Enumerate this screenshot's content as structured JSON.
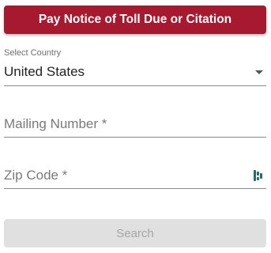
{
  "pay_button": {
    "label": "Pay Notice of Toll Due or Citation",
    "color": "#a6192e"
  },
  "country_select": {
    "label": "Select Country",
    "value": "United States"
  },
  "mailing_number": {
    "placeholder": "Mailing Number *",
    "value": ""
  },
  "zip_code": {
    "placeholder": "Zip Code *",
    "value": "",
    "icon": "password-manager-icon",
    "icon_color": "#1f6f6a"
  },
  "search_button": {
    "label": "Search",
    "disabled": true
  }
}
